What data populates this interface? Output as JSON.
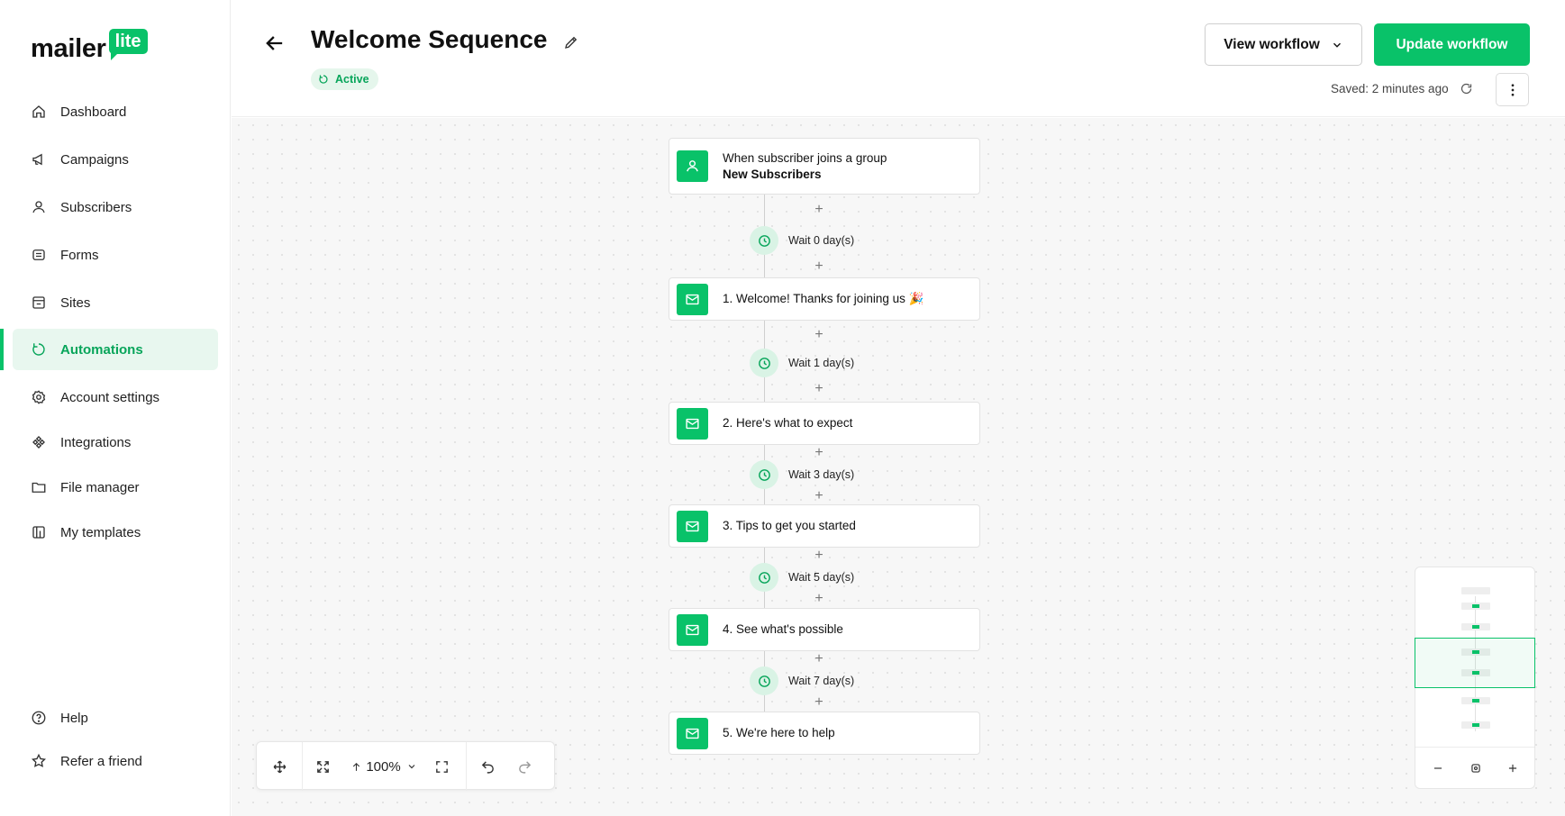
{
  "brand": {
    "word": "mailer",
    "badge": "lite",
    "accent": "#09c269"
  },
  "sidebar": {
    "items": [
      {
        "label": "Dashboard",
        "icon": "home-icon"
      },
      {
        "label": "Campaigns",
        "icon": "megaphone-icon"
      },
      {
        "label": "Subscribers",
        "icon": "person-icon"
      },
      {
        "label": "Forms",
        "icon": "forms-icon"
      },
      {
        "label": "Sites",
        "icon": "sites-icon"
      },
      {
        "label": "Automations",
        "icon": "automation-icon",
        "active": true
      },
      {
        "label": "Account settings",
        "icon": "gear-icon"
      },
      {
        "label": "Integrations",
        "icon": "integrations-icon"
      },
      {
        "label": "File manager",
        "icon": "folder-icon"
      },
      {
        "label": "My templates",
        "icon": "templates-icon"
      }
    ],
    "bottom": [
      {
        "label": "Help",
        "icon": "help-icon"
      },
      {
        "label": "Refer a friend",
        "icon": "star-icon"
      }
    ]
  },
  "header": {
    "title": "Welcome Sequence",
    "status": "Active",
    "view_workflow": "View workflow",
    "update_workflow": "Update workflow",
    "saved": "Saved: 2 minutes ago"
  },
  "workflow": {
    "trigger": {
      "line1": "When subscriber joins a group",
      "line2": "New Subscribers"
    },
    "waits": [
      "Wait 0 day(s)",
      "Wait 1 day(s)",
      "Wait 3 day(s)",
      "Wait 5 day(s)",
      "Wait 7 day(s)"
    ],
    "emails": [
      "1.  Welcome! Thanks for joining us 🎉",
      "2.  Here's what to expect",
      "3.  Tips to get you started",
      "4.  See what's possible",
      "5.  We're here to help"
    ],
    "plus": "+"
  },
  "toolbar": {
    "zoom": "100%"
  },
  "minimap": {}
}
